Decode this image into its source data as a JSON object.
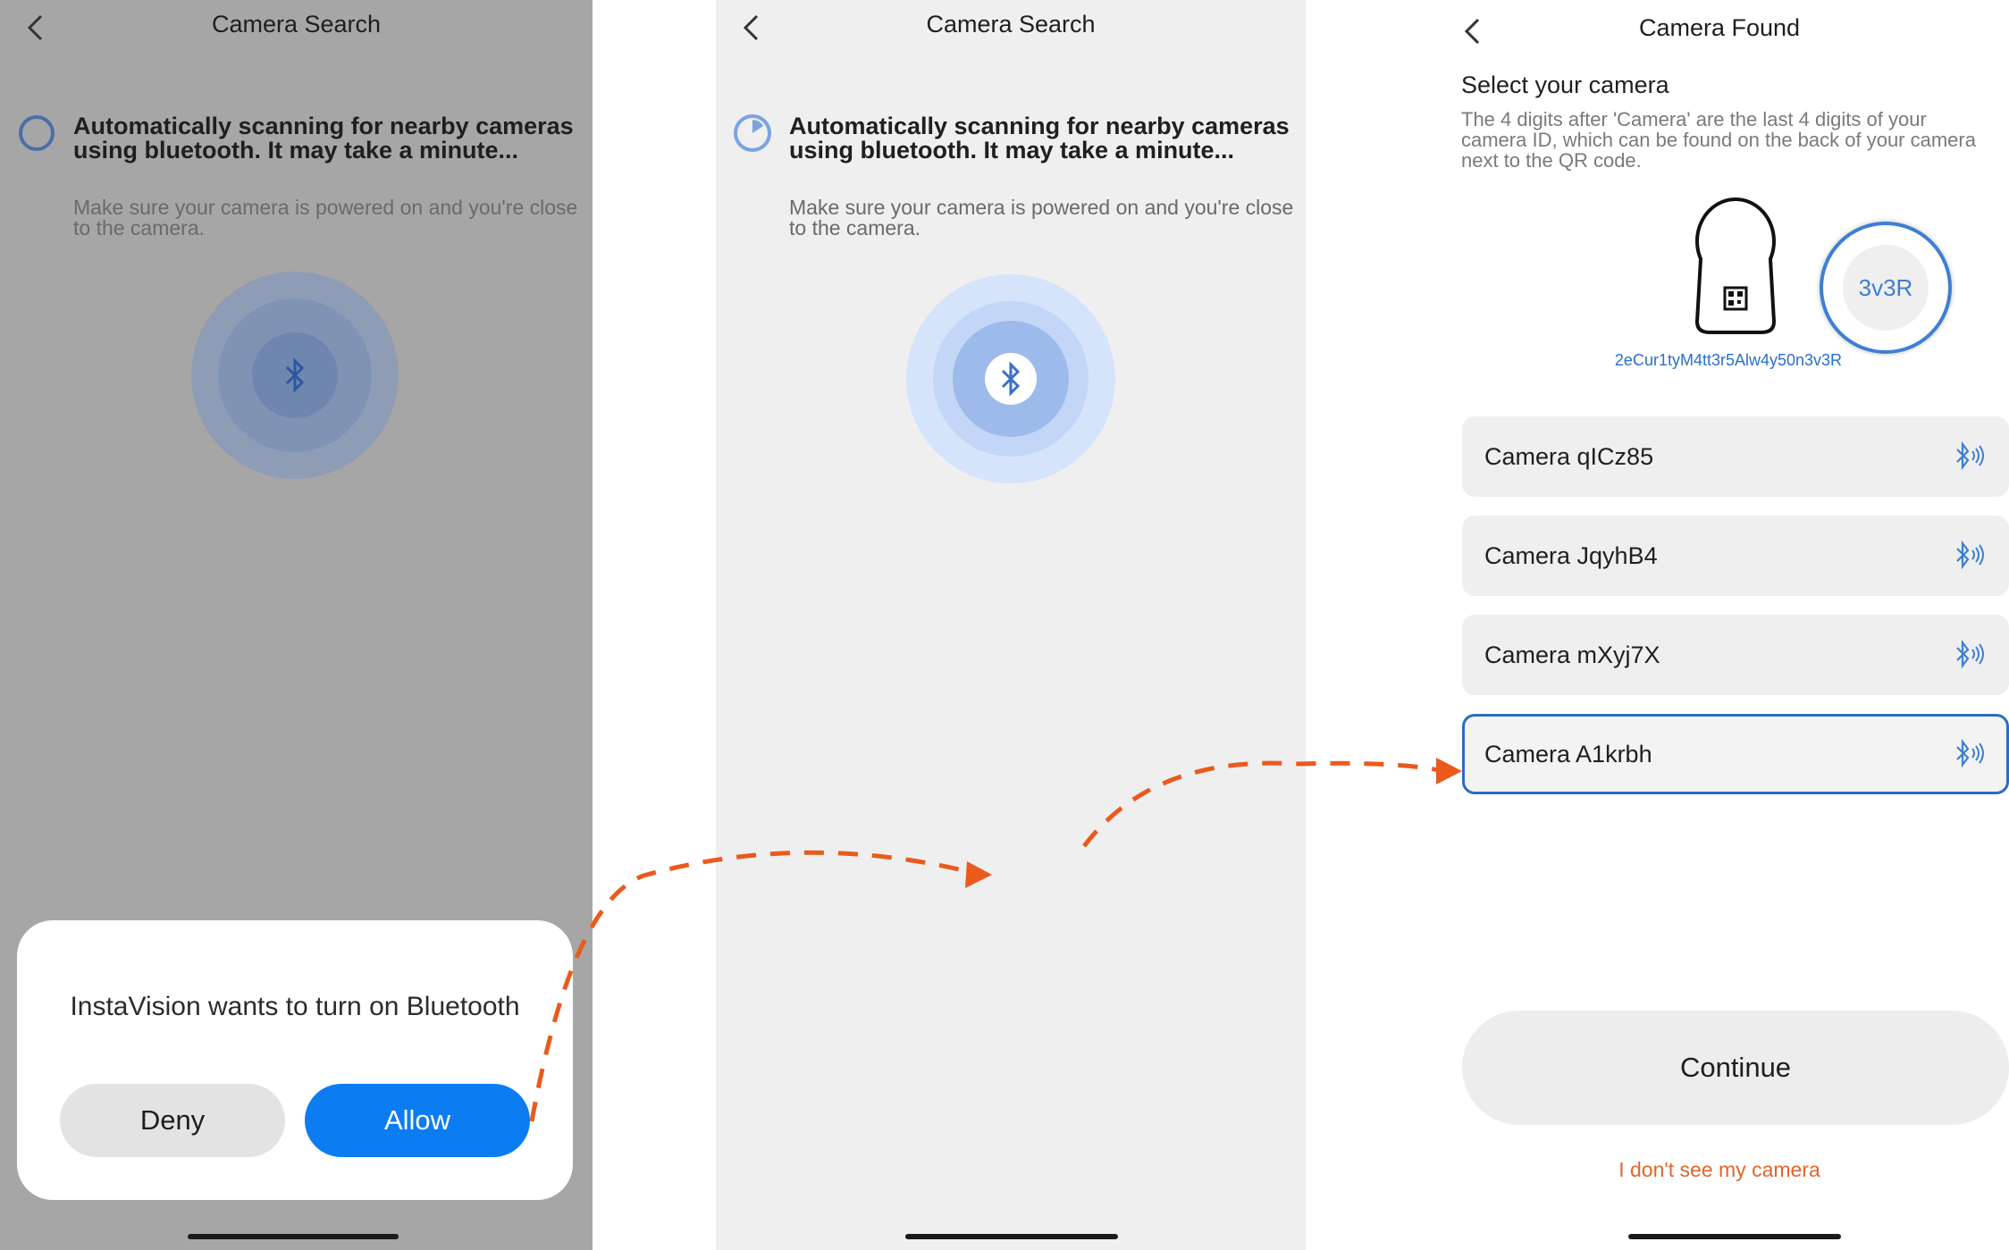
{
  "colors": {
    "accent": "#0b7cf2",
    "arrow": "#ea5a1c",
    "link": "#e0662a",
    "selected_border": "#2c6bc4"
  },
  "screen1": {
    "title": "Camera Search",
    "scan_title": "Automatically scanning for nearby cameras using bluetooth. It may take a minute...",
    "scan_subtitle": "Make sure your camera is powered on and you're close to the camera.",
    "dialog": {
      "message": "InstaVision wants to turn on Bluetooth",
      "deny_label": "Deny",
      "allow_label": "Allow"
    }
  },
  "screen2": {
    "title": "Camera Search",
    "scan_title": "Automatically scanning for nearby cameras using bluetooth. It may take a minute...",
    "scan_subtitle": "Make sure your camera is powered on and you're close to the camera."
  },
  "screen3": {
    "title": "Camera Found",
    "select_title": "Select your camera",
    "select_desc": "The 4 digits after 'Camera' are the last 4 digits of your camera ID, which can be found on the back of your camera next to the QR code.",
    "camera_id": "2eCur1tyM4tt3r5Alw4y50n3v3R",
    "badge": "3v3R",
    "cameras": [
      {
        "label": "Camera qICz85",
        "selected": false
      },
      {
        "label": "Camera JqyhB4",
        "selected": false
      },
      {
        "label": "Camera mXyj7X",
        "selected": false
      },
      {
        "label": "Camera A1krbh",
        "selected": true
      }
    ],
    "continue_label": "Continue",
    "no_camera_link": "I don't see my camera"
  }
}
